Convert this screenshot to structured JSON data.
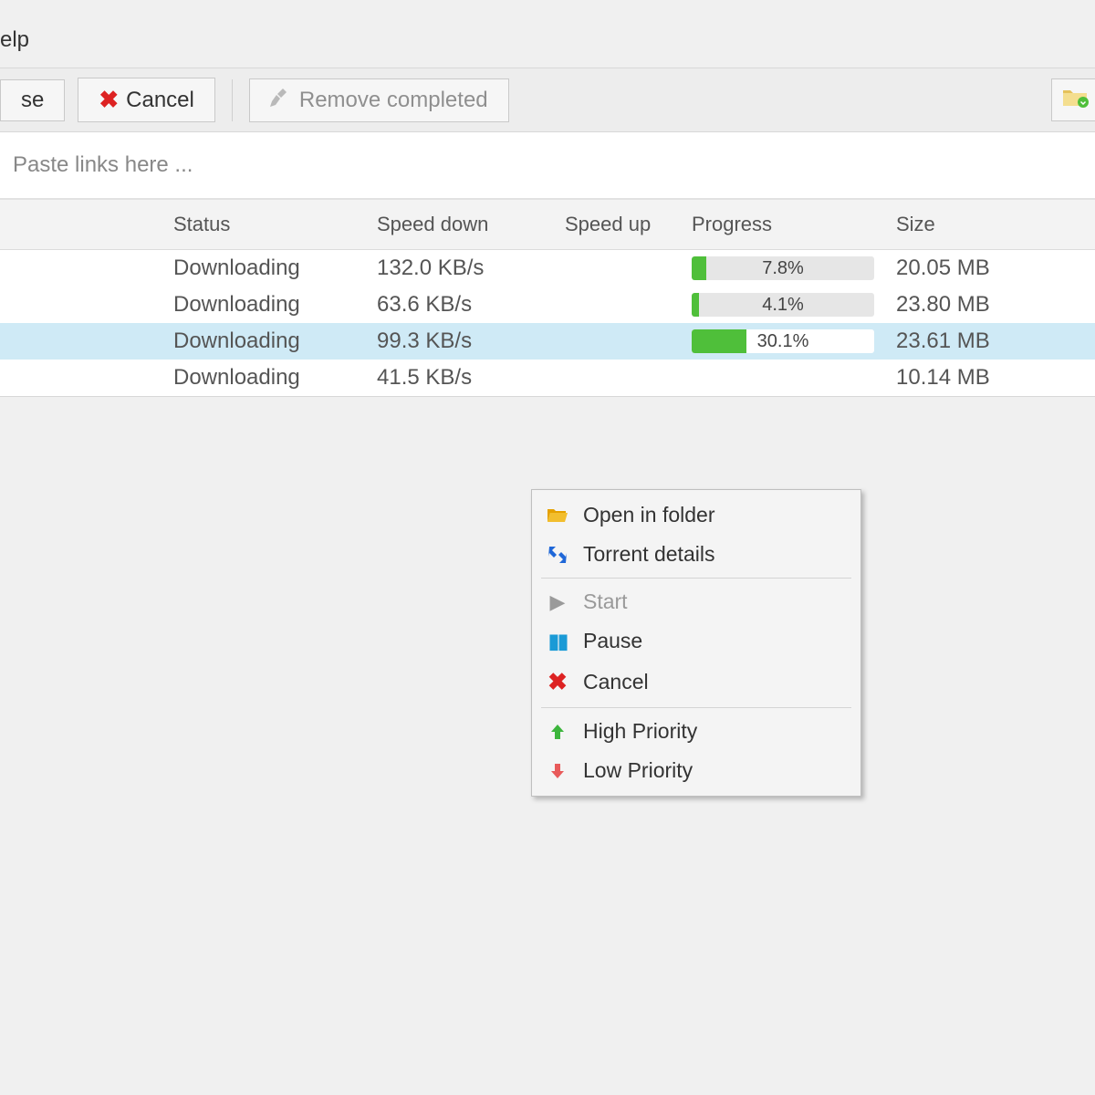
{
  "menu": {
    "help_fragment": "elp"
  },
  "toolbar": {
    "pause_fragment": "se",
    "cancel": "Cancel",
    "remove_completed": "Remove completed"
  },
  "linkbar": {
    "placeholder": "Paste links here ..."
  },
  "columns": {
    "status": "Status",
    "speed_down": "Speed down",
    "speed_up": "Speed up",
    "progress": "Progress",
    "size": "Size"
  },
  "rows": [
    {
      "status": "Downloading",
      "speed_down": "132.0 KB/s",
      "speed_up": "",
      "progress_pct": 7.8,
      "progress_label": "7.8%",
      "size": "20.05 MB",
      "selected": false
    },
    {
      "status": "Downloading",
      "speed_down": "63.6 KB/s",
      "speed_up": "",
      "progress_pct": 4.1,
      "progress_label": "4.1%",
      "size": "23.80 MB",
      "selected": false
    },
    {
      "status": "Downloading",
      "speed_down": "99.3 KB/s",
      "speed_up": "",
      "progress_pct": 30.1,
      "progress_label": "30.1%",
      "size": "23.61 MB",
      "selected": true
    },
    {
      "status": "Downloading",
      "speed_down": "41.5 KB/s",
      "speed_up": "",
      "progress_pct": null,
      "progress_label": "",
      "size": "10.14 MB",
      "selected": false
    }
  ],
  "context_menu": {
    "open_in_folder": "Open in folder",
    "torrent_details": "Torrent details",
    "start": "Start",
    "pause": "Pause",
    "cancel": "Cancel",
    "high_priority": "High Priority",
    "low_priority": "Low Priority"
  }
}
